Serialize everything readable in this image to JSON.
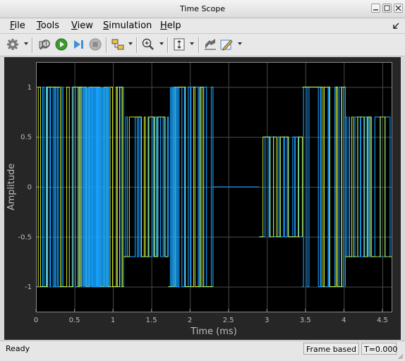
{
  "window": {
    "title": "Time Scope"
  },
  "menu": {
    "items": [
      "File",
      "Tools",
      "View",
      "Simulation",
      "Help"
    ]
  },
  "toolbar": {
    "buttons": [
      "settings-icon",
      "highlight-block-icon",
      "run-icon",
      "step-forward-icon",
      "stop-icon",
      "signal-select-icon",
      "zoom-in-icon",
      "scale-axes-icon",
      "restore-view-icon",
      "edit-icon"
    ]
  },
  "chart_data": {
    "type": "line",
    "xlabel": "Time (ms)",
    "ylabel": "Amplitude",
    "xlim": [
      0,
      4.62
    ],
    "ylim": [
      -1.25,
      1.25
    ],
    "xticks": [
      "0",
      "0.5",
      "1",
      "1.5",
      "2",
      "2.5",
      "3",
      "3.5",
      "4",
      "4.5"
    ],
    "yticks": [
      "-1",
      "-0.5",
      "0",
      "0.5",
      "1"
    ],
    "grid": true,
    "background": "#000000",
    "series": [
      {
        "color": "#e5ff2c",
        "style": "dense square wave"
      },
      {
        "color": "#16a1ff",
        "style": "dense square wave"
      }
    ],
    "segments": [
      {
        "x": [
          0.0,
          0.58
        ],
        "amplitude": 1.0
      },
      {
        "x": [
          0.58,
          1.14
        ],
        "amplitude": 1.0
      },
      {
        "x": [
          1.14,
          1.72
        ],
        "amplitude": 0.7
      },
      {
        "x": [
          1.72,
          2.3
        ],
        "amplitude": 1.0
      },
      {
        "x": [
          2.3,
          2.9
        ],
        "amplitude": 0.0
      },
      {
        "x": [
          2.9,
          3.46
        ],
        "amplitude": 0.5
      },
      {
        "x": [
          3.46,
          4.02
        ],
        "amplitude": 1.0
      },
      {
        "x": [
          4.02,
          4.62
        ],
        "amplitude": 0.7
      }
    ]
  },
  "status": {
    "state": "Ready",
    "mode": "Frame based",
    "time": "T=0.000"
  },
  "colors": {
    "yellow": "#e5ff2c",
    "blue": "#16a1ff",
    "axesText": "#bdbdbd",
    "grid": "#4a4a4a"
  }
}
